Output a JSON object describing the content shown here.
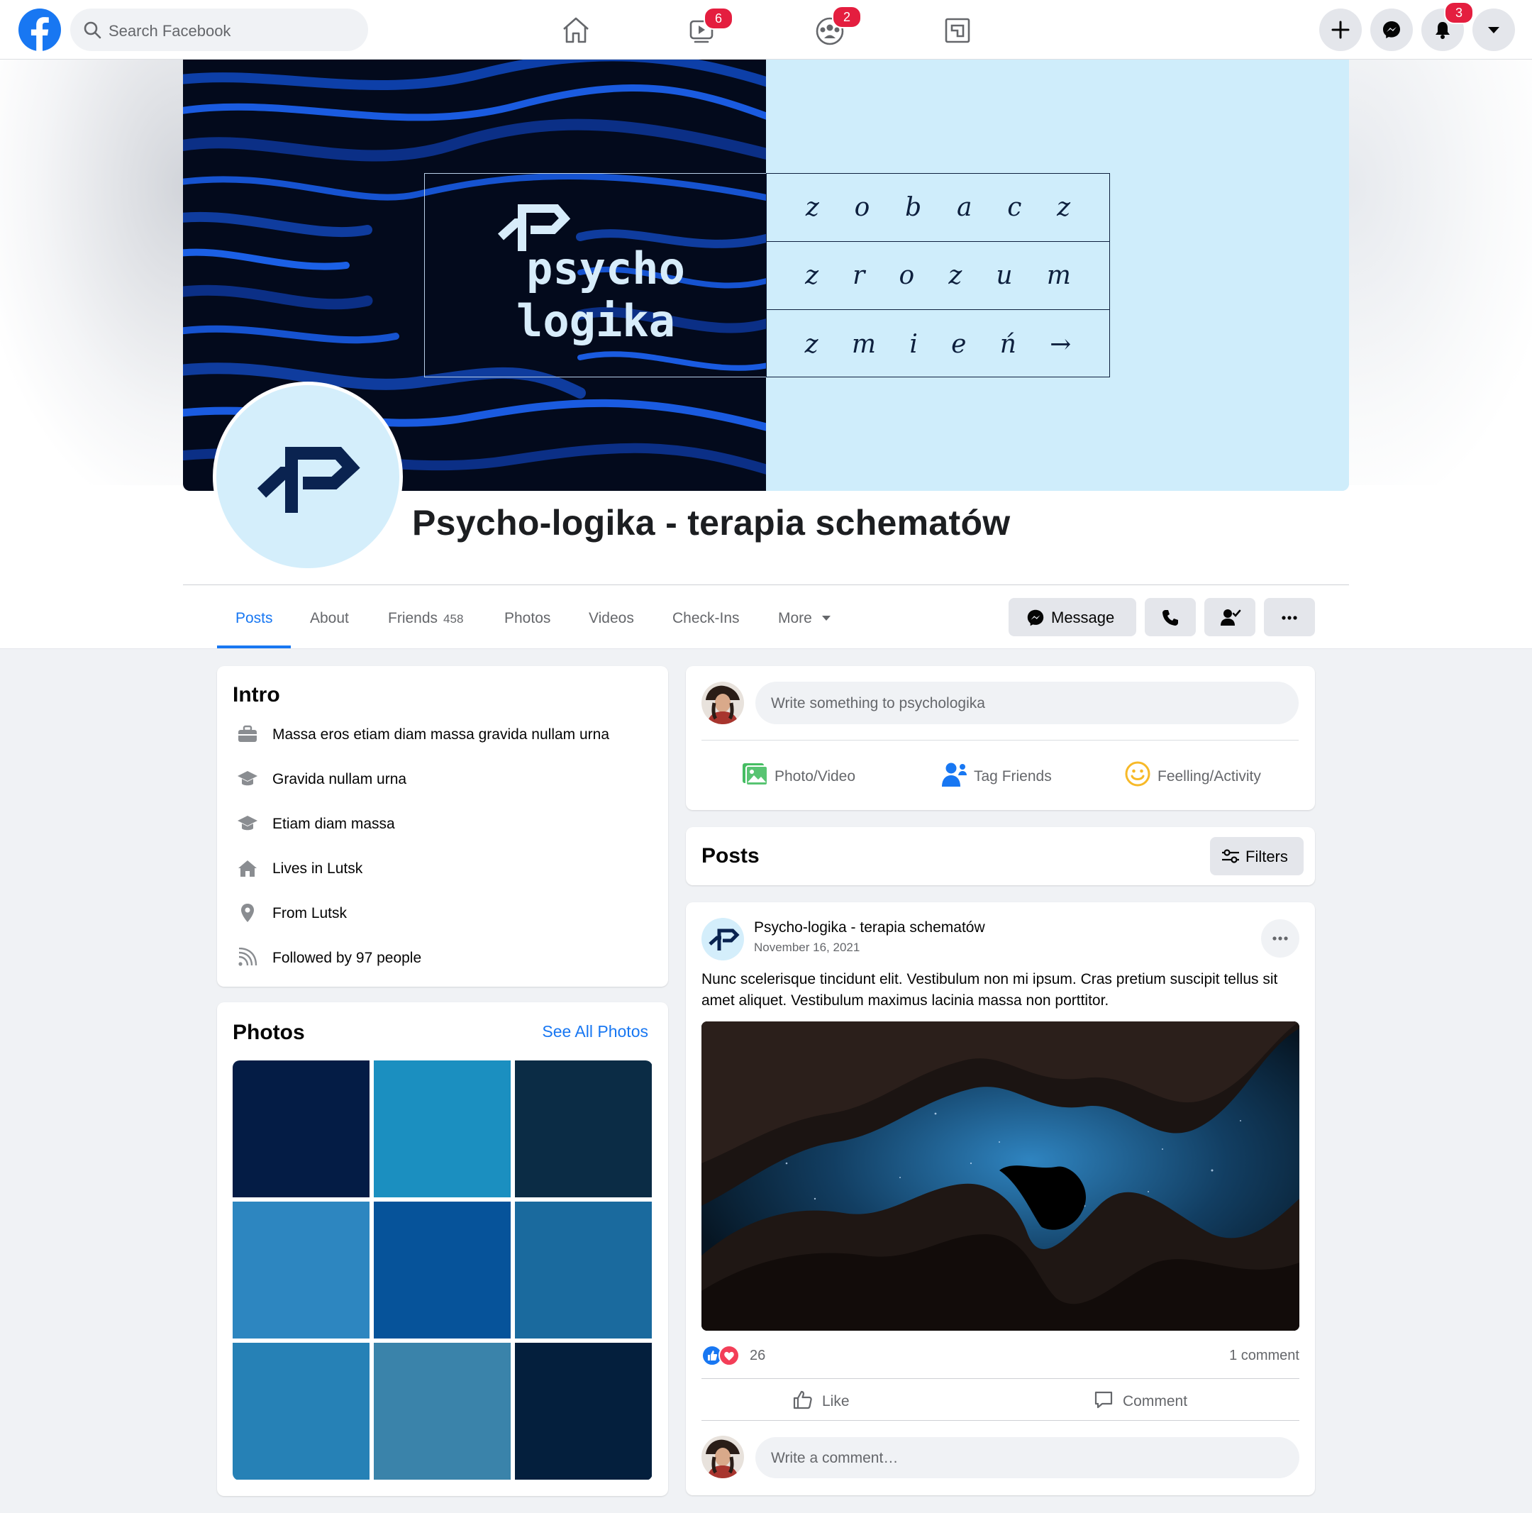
{
  "topbar": {
    "search_placeholder": "Search Facebook",
    "watch_badge": "6",
    "groups_badge": "2",
    "notifications_badge": "3"
  },
  "cover": {
    "brand_line1": "psycho",
    "brand_line2": "logika",
    "grid_rows": [
      [
        "z",
        "o",
        "b",
        "a",
        "c",
        "z"
      ],
      [
        "z",
        "r",
        "o",
        "z",
        "u",
        "m"
      ],
      [
        "z",
        "m",
        "i",
        "e",
        "ń",
        "→"
      ]
    ]
  },
  "profile": {
    "name": "Psycho-logika - terapia schematów"
  },
  "tabs": [
    {
      "label": "Posts"
    },
    {
      "label": "About"
    },
    {
      "label": "Friends",
      "count": "458"
    },
    {
      "label": "Photos"
    },
    {
      "label": "Videos"
    },
    {
      "label": "Check-Ins"
    },
    {
      "label": "More"
    }
  ],
  "header_actions": {
    "message_label": "Message"
  },
  "intro": {
    "title": "Intro",
    "items": [
      {
        "icon": "briefcase-icon",
        "text": "Massa eros etiam diam massa gravida nullam urna"
      },
      {
        "icon": "graduation-cap-icon",
        "text": "Gravida nullam urna"
      },
      {
        "icon": "graduation-cap-icon",
        "text": "Etiam diam massa"
      },
      {
        "icon": "home-icon",
        "text": "Lives in Lutsk"
      },
      {
        "icon": "location-pin-icon",
        "text": "From Lutsk"
      },
      {
        "icon": "rss-icon",
        "text": "Followed by 97 people"
      }
    ]
  },
  "photos": {
    "title": "Photos",
    "see_all": "See All Photos",
    "tiles": [
      "#041c45",
      "#1b8fc0",
      "#0b2c45",
      "#2d86c0",
      "#06539a",
      "#1a6a9e",
      "#2681b6",
      "#3a83aa",
      "#041f3d"
    ]
  },
  "composer": {
    "placeholder": "Write something to psychologika",
    "actions": [
      "Photo/Video",
      "Tag Friends",
      "Feelling/Activity"
    ]
  },
  "posts_section": {
    "title": "Posts",
    "filters_label": "Filters"
  },
  "post": {
    "author": "Psycho-logika - terapia schematów",
    "date": "November 16, 2021",
    "text": "Nunc scelerisque tincidunt elit. Vestibulum non mi ipsum. Cras pretium suscipit tellus sit amet aliquet. Vestibulum maximus lacinia massa non porttitor.",
    "reaction_count": "26",
    "comment_count": "1 comment",
    "like_label": "Like",
    "comment_label": "Comment",
    "comment_placeholder": "Write a comment…"
  },
  "colors": {
    "facebook_blue": "#1877f2",
    "badge_red": "#e41e3f",
    "cover_light": "#cfedfb",
    "brand_navy": "#0d1f3d"
  }
}
